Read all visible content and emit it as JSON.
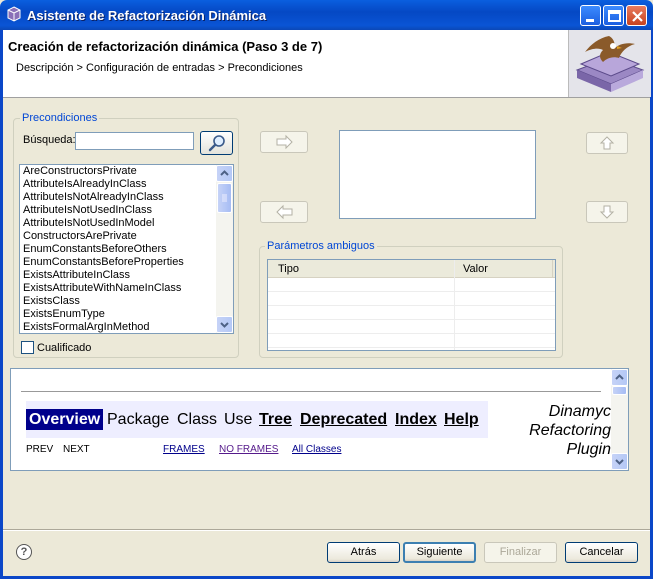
{
  "window": {
    "title": "Asistente de Refactorización Dinámica"
  },
  "header": {
    "title": "Creación de refactorización dinámica (Paso 3 de 7)",
    "breadcrumb": "Descripción > Configuración de entradas > Precondiciones"
  },
  "preconditions": {
    "group_label": "Precondiciones",
    "search_label": "Búsqueda:",
    "search_value": "",
    "items": [
      "AreConstructorsPrivate",
      "AttributeIsAlreadyInClass",
      "AttributeIsNotAlreadyInClass",
      "AttributeIsNotUsedInClass",
      "AttributeIsNotUsedInModel",
      "ConstructorsArePrivate",
      "EnumConstantsBeforeOthers",
      "EnumConstantsBeforeProperties",
      "ExistsAttributeInClass",
      "ExistsAttributeWithNameInClass",
      "ExistsClass",
      "ExistsEnumType",
      "ExistsFormalArgInMethod"
    ],
    "qualified_label": "Cualificado",
    "qualified_checked": false
  },
  "ambiguous": {
    "group_label": "Parámetros ambiguos",
    "columns": [
      "Tipo",
      "Valor"
    ]
  },
  "javadoc": {
    "nav_active": "Overview",
    "nav_items": [
      "Package",
      "Class",
      "Use"
    ],
    "nav_links": [
      "Tree",
      "Deprecated",
      "Index",
      "Help"
    ],
    "caption": [
      "Dinamyc",
      "Refactoring",
      "Plugin"
    ],
    "prev": "PREV",
    "next": "NEXT",
    "frames": "FRAMES",
    "no_frames": "NO FRAMES",
    "all_classes": "All Classes"
  },
  "footer": {
    "help": "?",
    "back": "Atrás",
    "next": "Siguiente",
    "finish": "Finalizar",
    "cancel": "Cancelar"
  }
}
